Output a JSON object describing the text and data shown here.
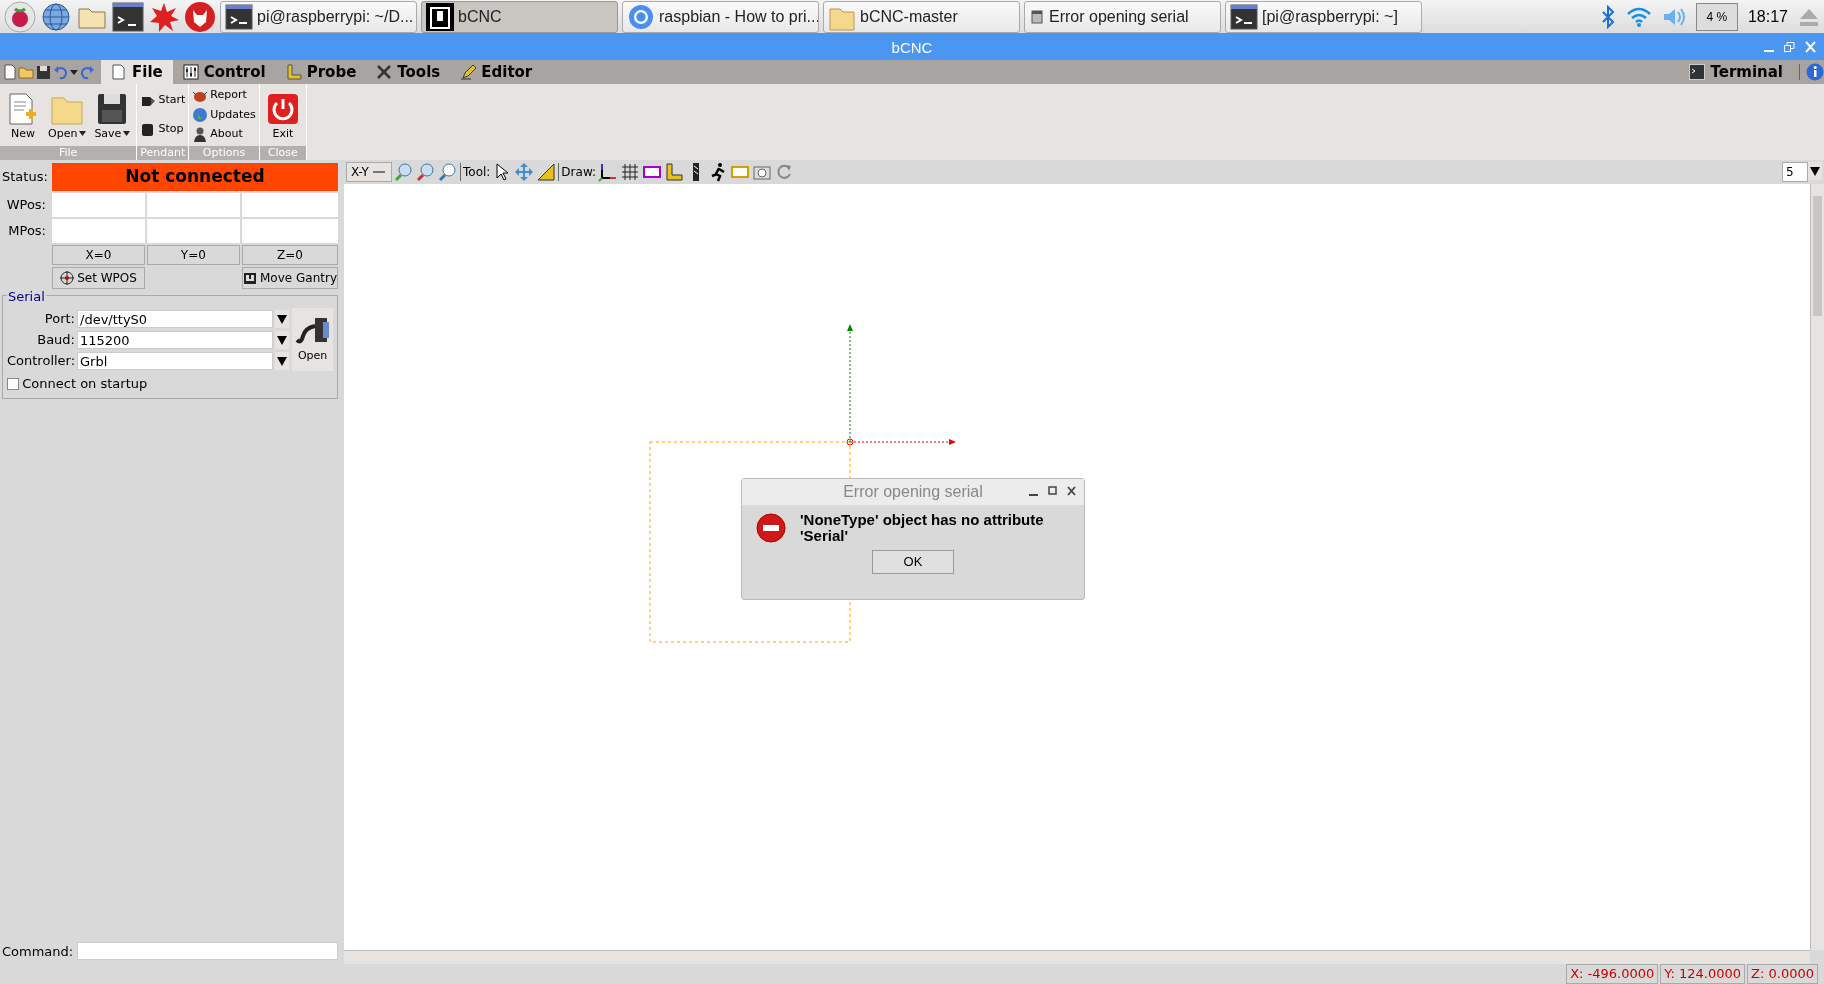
{
  "taskbar": {
    "tasks": [
      {
        "label": "pi@raspberrypi: ~/D...",
        "selected": false
      },
      {
        "label": "bCNC",
        "selected": true
      },
      {
        "label": "raspbian - How to pri...",
        "selected": false
      },
      {
        "label": "bCNC-master",
        "selected": false
      },
      {
        "label": "Error opening serial",
        "selected": false
      },
      {
        "label": "[pi@raspberrypi: ~]",
        "selected": false
      }
    ],
    "cpu": "4 %",
    "clock": "18:17"
  },
  "window": {
    "title": "bCNC"
  },
  "tabs": [
    {
      "label": "File",
      "selected": true
    },
    {
      "label": "Control",
      "selected": false
    },
    {
      "label": "Probe",
      "selected": false
    },
    {
      "label": "Tools",
      "selected": false
    },
    {
      "label": "Editor",
      "selected": false
    }
  ],
  "terminal_tab": {
    "label": "Terminal"
  },
  "ribbon": [
    {
      "label": "File",
      "items": [
        {
          "label": "New",
          "kind": "large"
        },
        {
          "label": "Open",
          "kind": "menu"
        },
        {
          "label": "Save",
          "kind": "menu"
        }
      ]
    },
    {
      "label": "Pendant",
      "items": [
        {
          "label": "Start",
          "kind": "small"
        },
        {
          "label": "Stop",
          "kind": "small"
        }
      ]
    },
    {
      "label": "Options",
      "items": [
        {
          "label": "Report",
          "kind": "small"
        },
        {
          "label": "Updates",
          "kind": "small"
        },
        {
          "label": "About",
          "kind": "small"
        }
      ]
    },
    {
      "label": "Close",
      "items": [
        {
          "label": "Exit",
          "kind": "large"
        }
      ]
    }
  ],
  "dro": {
    "status_label": "Status:",
    "status": "Not connected",
    "wpos_label": "WPos:",
    "mpos_label": "MPos:",
    "zero_buttons": [
      "X=0",
      "Y=0",
      "Z=0"
    ],
    "set_wpos": "Set WPOS",
    "move_gantry": "Move Gantry"
  },
  "serial": {
    "title": "Serial",
    "fields": [
      {
        "label": "Port:",
        "value": "/dev/ttyS0"
      },
      {
        "label": "Baud:",
        "value": "115200"
      },
      {
        "label": "Controller:",
        "value": "Grbl"
      }
    ],
    "open_button": "Open",
    "connect_on_startup": {
      "label": "Connect on startup",
      "checked": false
    }
  },
  "command": {
    "label": "Command:"
  },
  "canvas_toolbar": {
    "view": "X-Y",
    "tool_label": "Tool:",
    "draw_label": "Draw:",
    "zoom_value": "5"
  },
  "dialog": {
    "title": "Error opening serial",
    "message": "'NoneType' object has no attribute 'Serial'",
    "button": "OK"
  },
  "status_bar": {
    "x": "X: -496.0000",
    "y": "Y: 124.0000",
    "z": "Z: 0.0000"
  }
}
